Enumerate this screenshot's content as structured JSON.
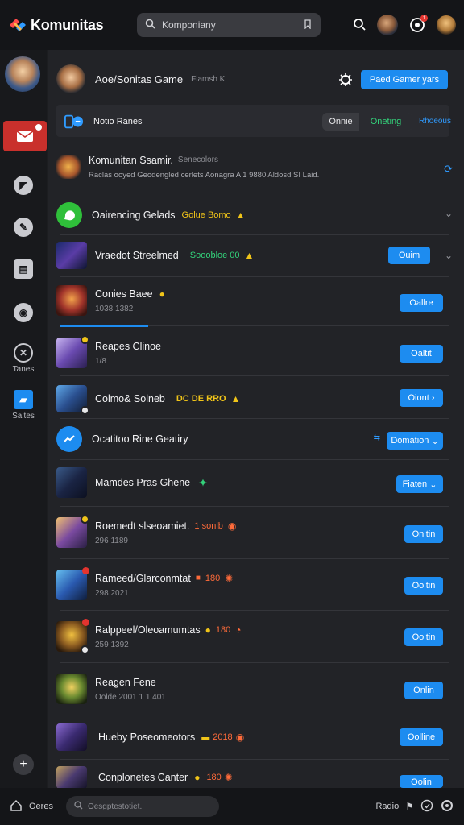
{
  "header": {
    "app_title": "Komunitas",
    "search_text": "Komponiany",
    "icons": [
      "search-icon",
      "bell-icon",
      "avatar"
    ],
    "notification_count": "1"
  },
  "sidebar": {
    "items": [
      {
        "label": "",
        "icon": "mail-icon",
        "active": true
      },
      {
        "label": "",
        "icon": "compass-icon"
      },
      {
        "label": "",
        "icon": "edit-icon"
      },
      {
        "label": "",
        "icon": "card-icon"
      },
      {
        "label": "",
        "icon": "gamepad-icon"
      },
      {
        "label": "Tanes",
        "icon": "globe-icon"
      },
      {
        "label": "Saltes",
        "icon": "folder-icon"
      }
    ],
    "add_label": "+"
  },
  "main": {
    "header_title": "Aoe/Sonitas Game",
    "header_sub": "Flamsh K",
    "header_button": "Paed Gamer yars",
    "notice_label": "Notio Ranes",
    "status_left": "Onnie",
    "status_right": "Oneting",
    "status_link": "Rhoeous",
    "featured_title": "Komunitan Ssamir.",
    "featured_meta": "Senecolors",
    "featured_sub": "Raclas ooyed Geodengled cerlets Aonagra A 1 9880 Aldosd SI Laid.",
    "rows": [
      {
        "title": "Oairencing Gelads",
        "tag": "Golue Bomo",
        "button": "",
        "sub": ""
      },
      {
        "title": "Vraedot Streelmed",
        "tag": "Sooobloe 00",
        "button": "Ouim",
        "sub": ""
      },
      {
        "title": "Conies Baee",
        "tag": "",
        "button": "Oallre",
        "sub": "1038 1382"
      },
      {
        "title": "Reapes Clinoe",
        "tag": "",
        "button": "Oaltit",
        "sub": "1/8"
      },
      {
        "title": "Colmo& Solneb",
        "tag": "DC DE RRO",
        "button": "Oiont",
        "sub": ""
      },
      {
        "title": "Ocatitoo Rine Geatiry",
        "tag": "",
        "button": "Domation",
        "sub": ""
      },
      {
        "title": "Mamdes Pras Ghene",
        "tag": "",
        "button": "Fiaten",
        "sub": ""
      },
      {
        "title": "Roemedt slseoamiet.",
        "tag": "1 sonlb",
        "button": "Onltin",
        "sub": "296 1189"
      },
      {
        "title": "Rameed/Glarconmtat",
        "tag": "180",
        "button": "Ooltin",
        "sub": "298 2021"
      },
      {
        "title": "Ralppeel/Oleoamumtas",
        "tag": "180",
        "button": "Ooltin",
        "sub": "259 1392"
      },
      {
        "title": "Reagen Fene",
        "tag": "",
        "button": "Onlin",
        "sub": "Oolde 2001 1 1 401"
      },
      {
        "title": "Hueby Poseomeotors",
        "tag": "2018",
        "button": "Oolline",
        "sub": ""
      },
      {
        "title": "Conplonetes Canter",
        "tag": "180",
        "button": "Oolin",
        "sub": ""
      }
    ]
  },
  "footer": {
    "left_label": "Oeres",
    "search_placeholder": "Oesgptestotiet.",
    "right_label": "Radio"
  },
  "colors": {
    "accent": "#1d8cf0",
    "tag_yellow": "#f0c419",
    "tag_green": "#33d17a",
    "tag_orange": "#ff6b3a",
    "badge_red": "#e3342f"
  }
}
